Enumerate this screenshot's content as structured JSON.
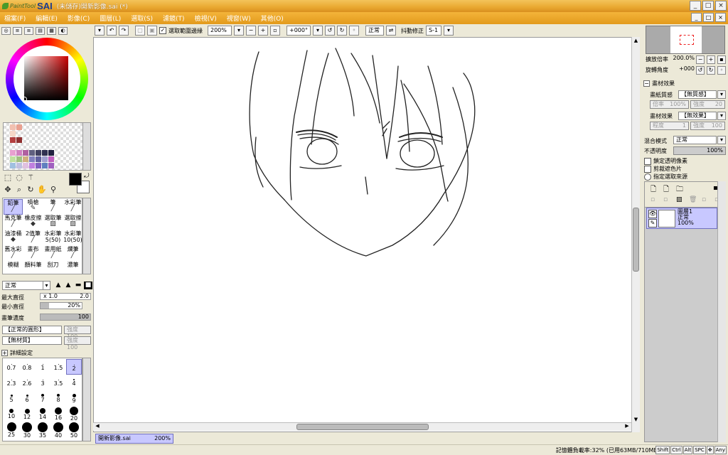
{
  "app": {
    "brand_small": "PaintTool",
    "brand": "SAI",
    "window_title": "(未儲存)開新影像.sai (*)"
  },
  "window_buttons": {
    "minimize": "_",
    "maximize": "□",
    "close": "×"
  },
  "menu": [
    "檔案(F)",
    "編輯(E)",
    "影像(C)",
    "圖層(L)",
    "選取(S)",
    "濾鏡(T)",
    "檢視(V)",
    "視窗(W)",
    "其他(O)"
  ],
  "toolbar": {
    "sel_edge_label": "選取範圍邊緣",
    "zoom": "200%",
    "rotation": "+000°",
    "mode": "正常",
    "stabilizer_label": "抖動修正",
    "stabilizer": "S-1"
  },
  "left": {
    "tools": {
      "fg": "#000000",
      "bg": "#ffffff"
    },
    "brushes": [
      "鉛筆",
      "噴槍",
      "筆",
      "水彩筆",
      "馬克筆",
      "橡皮擦",
      "選取筆",
      "選取擦",
      "油漆桶",
      "2值筆",
      "水彩筆 5(50)",
      "水彩筆 10(50)",
      "舊水彩",
      "畫布",
      "畫用紙",
      "爛筆",
      "模糊",
      "顏料筆",
      "刮刀",
      "濃筆"
    ],
    "blend_mode": "正常",
    "max_size_label": "最大直徑",
    "max_size_mult": "x 1.0",
    "max_size": "2.0",
    "min_size_label": "最小直徑",
    "min_size": "20%",
    "density_label": "畫筆濃度",
    "density": "100",
    "shape": "【正常的圓形】",
    "shape_strength": "強度 100",
    "texture": "【無材質】",
    "texture_strength": "強度 100",
    "detail": "詳細設定",
    "sizes": [
      "0.7",
      "0.8",
      "1",
      "1.5",
      "2",
      "2.3",
      "2.6",
      "3",
      "3.5",
      "4",
      "5",
      "6",
      "7",
      "8",
      "9",
      "10",
      "12",
      "14",
      "16",
      "20",
      "25",
      "30",
      "35",
      "40",
      "50"
    ]
  },
  "canvas": {
    "doc_tab": "開新影像.sai",
    "doc_zoom": "200%"
  },
  "right": {
    "zoom_label": "擴放倍率",
    "zoom": "200.0%",
    "rotate_label": "旋轉角度",
    "rotate": "+000",
    "paper_effects": "畫材效果",
    "paper_label": "畫紙質感",
    "paper": "【無質感】",
    "paper_mult_label": "倍率",
    "paper_mult": "100%",
    "paper_str_label": "強度",
    "paper_str": "20",
    "effect_label": "畫材效果",
    "effect": "【無效果】",
    "effect_deg_label": "程度",
    "effect_deg": "1",
    "effect_str_label": "強度",
    "effect_str": "100",
    "blend_label": "混合模式",
    "blend": "正常",
    "opacity_label": "不透明度",
    "opacity": "100%",
    "chk1": "鎖定透明像素",
    "chk2": "剪裁遮色片",
    "chk3": "指定選取來源",
    "layer": {
      "name": "圖層1",
      "mode": "正常",
      "opacity": "100%"
    }
  },
  "status": {
    "text": "記憶體負載率:32% (已用63MB/710MB)",
    "keys": [
      "Shift",
      "Ctrl",
      "Alt",
      "SPC",
      "✥",
      "Any"
    ]
  }
}
